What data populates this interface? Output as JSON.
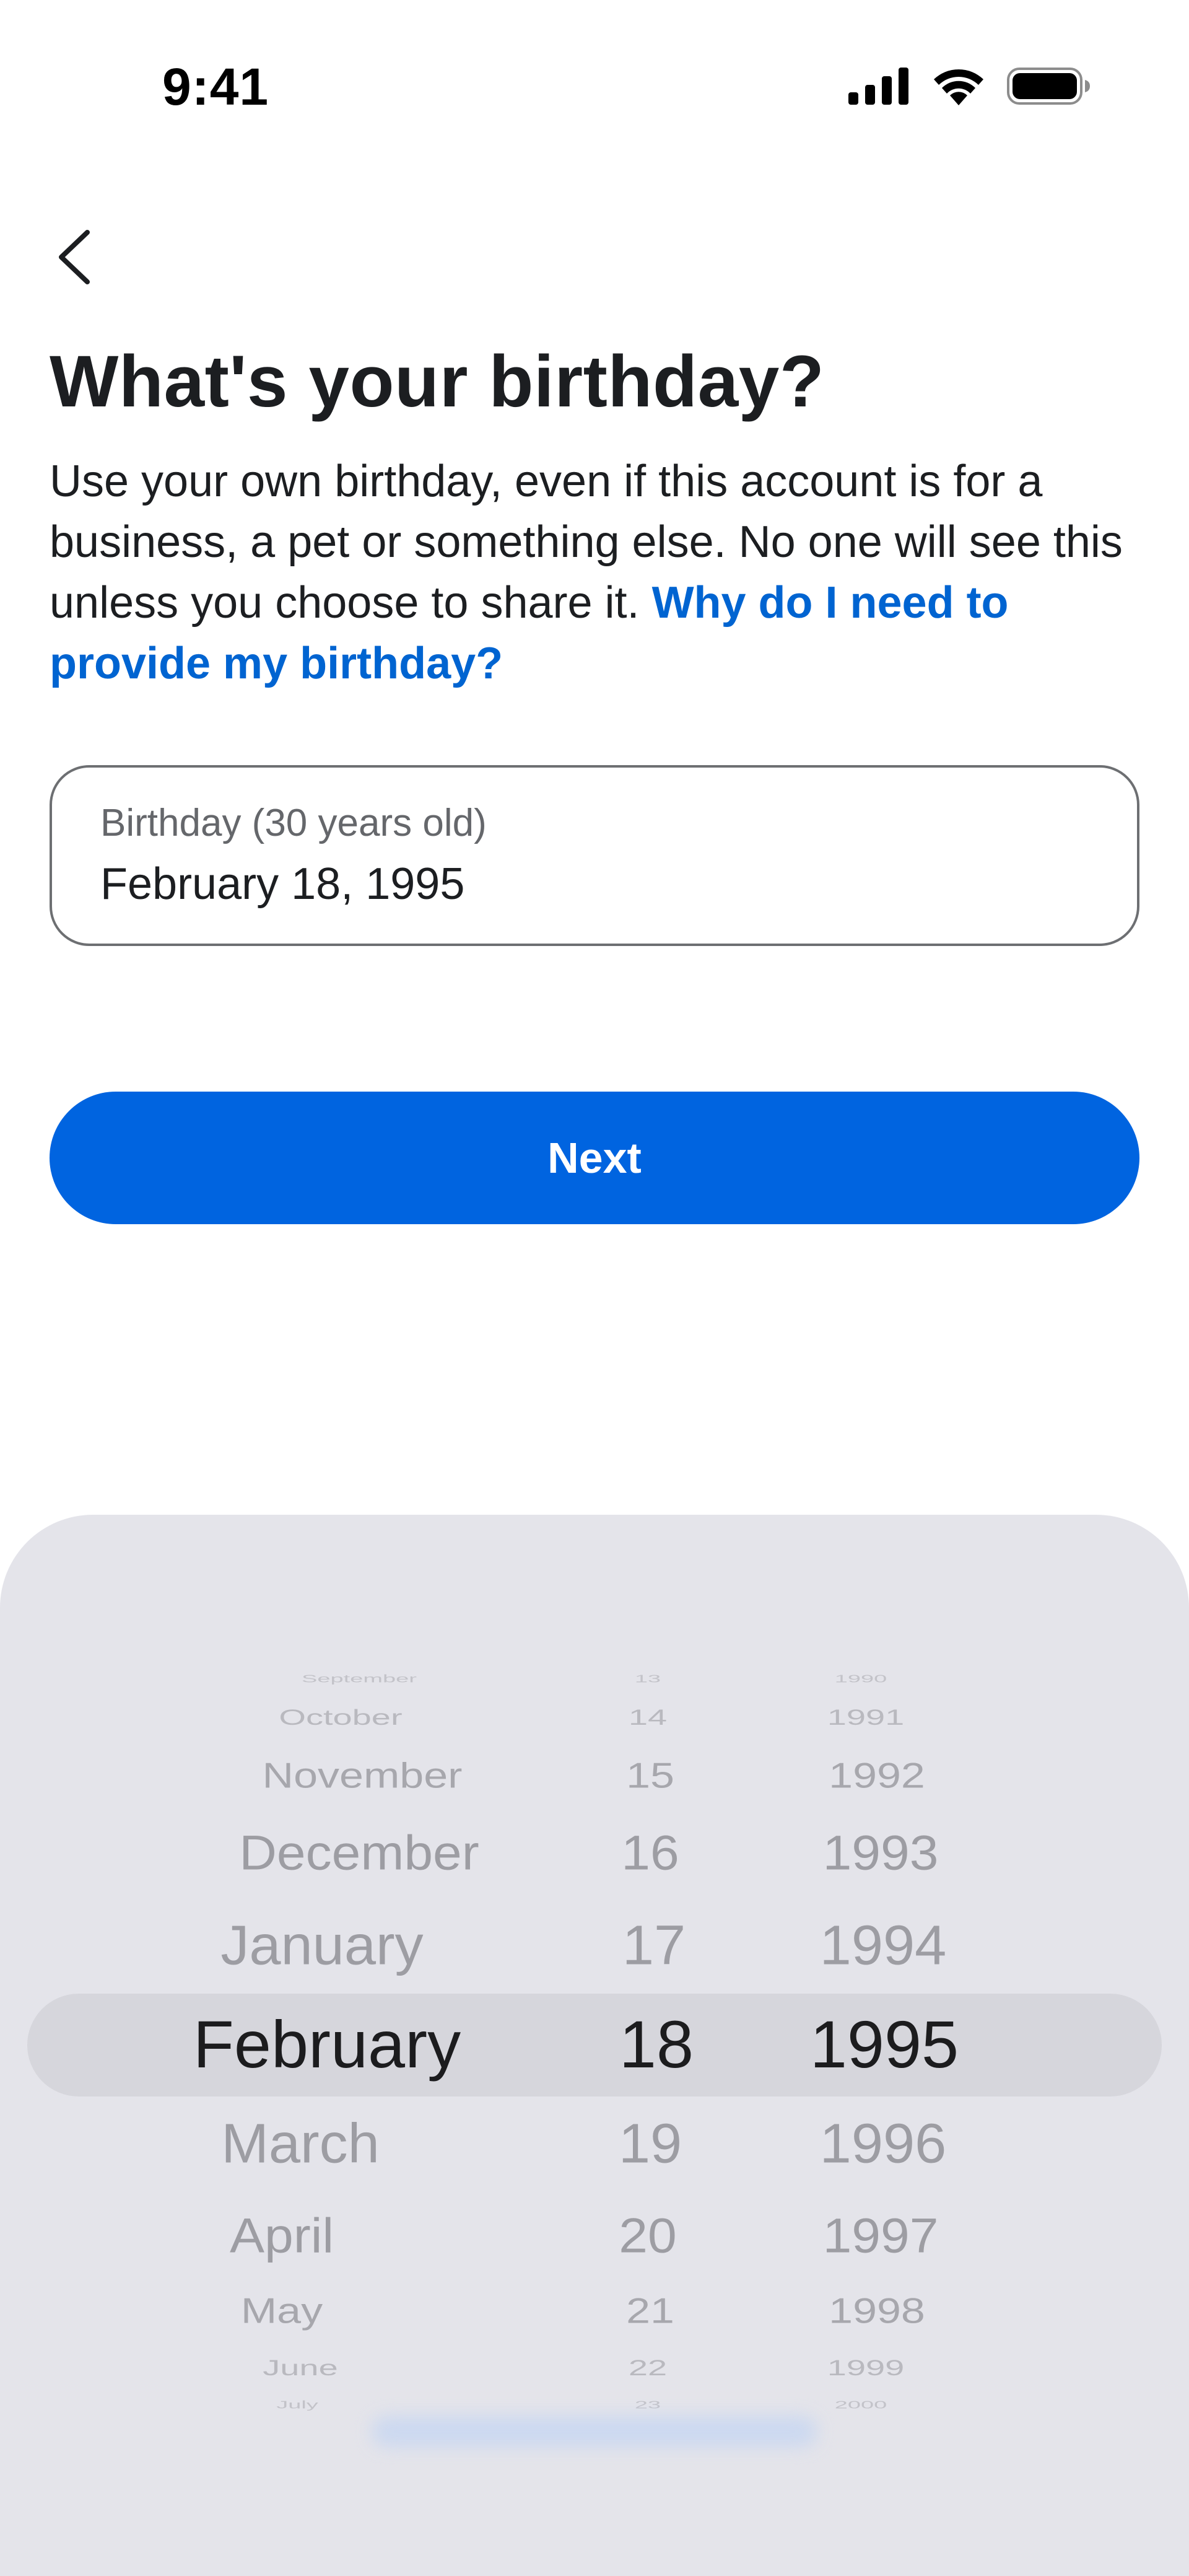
{
  "status_bar": {
    "time": "9:41",
    "icons": [
      "cellular-signal-icon",
      "wifi-icon",
      "battery-icon"
    ]
  },
  "nav": {
    "back_icon": "chevron-left-icon"
  },
  "title": "What's your birthday?",
  "description": {
    "text": "Use your own birthday, even if this account is for a business, a pet or something else. No one will see this unless you choose to share it. ",
    "link": "Why do I need to provide my birthday?"
  },
  "birthday_field": {
    "label": "Birthday (30 years old)",
    "value": "February 18, 1995"
  },
  "next_button": {
    "label": "Next"
  },
  "picker": {
    "months": [
      "September",
      "October",
      "November",
      "December",
      "January",
      "February",
      "March",
      "April",
      "May",
      "June",
      "July"
    ],
    "days": [
      "13",
      "14",
      "15",
      "16",
      "17",
      "18",
      "19",
      "20",
      "21",
      "22",
      "23"
    ],
    "years": [
      "1990",
      "1991",
      "1992",
      "1993",
      "1994",
      "1995",
      "1996",
      "1997",
      "1998",
      "1999",
      "2000"
    ],
    "selected_index": 5
  },
  "colors": {
    "accent": "#0064e0",
    "link": "#0064d1",
    "sheet": "#e4e4ea",
    "selection_band": "#d6d6dc"
  }
}
